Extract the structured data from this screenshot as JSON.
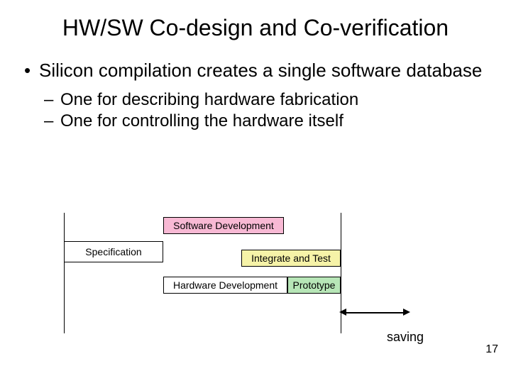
{
  "title": "HW/SW Co-design and Co-verification",
  "bullets": {
    "main": "Silicon compilation creates a single software database",
    "sub1": "One for describing hardware fabrication",
    "sub2": "One for controlling the hardware itself"
  },
  "diagram": {
    "specification": "Specification",
    "software_dev": "Software Development",
    "hardware_dev": "Hardware Development",
    "integrate_test": "Integrate and Test",
    "prototype": "Prototype",
    "saving": "saving"
  },
  "page_number": "17",
  "colors": {
    "software": "#f8b9d4",
    "integrate": "#f6f3a8",
    "prototype": "#b7e6b7"
  }
}
